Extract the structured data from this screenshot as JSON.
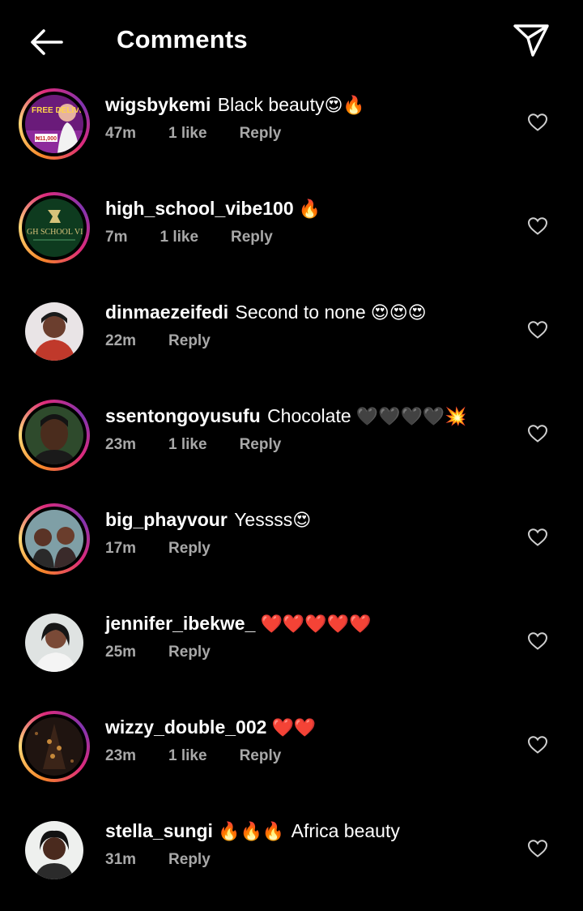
{
  "header": {
    "title": "Comments",
    "back_icon": "arrow-left-icon",
    "share_icon": "paper-plane-icon"
  },
  "colors": {
    "background": "#000000",
    "text": "#ffffff",
    "meta": "#a8a8a8",
    "story_ring": [
      "#f58529",
      "#dd2a7b",
      "#8134af"
    ]
  },
  "comments": [
    {
      "username": "wigsbykemi",
      "text": "Black beauty",
      "emojis": "😍🔥",
      "time": "47m",
      "likes": "1 like",
      "reply": "Reply",
      "story_ring": true,
      "avatar_text": "FREE DELIVERY",
      "avatar_price": "₦11,000"
    },
    {
      "username": "high_school_vibe100",
      "text": "",
      "emojis": " 🔥",
      "time": "7m",
      "likes": "1 like",
      "reply": "Reply",
      "story_ring": true,
      "avatar_text": "GH SCHOOL VI"
    },
    {
      "username": "dinmaezeifedi",
      "text": "Second to none",
      "emojis": " 😍😍😍",
      "time": "22m",
      "likes": "",
      "reply": "Reply",
      "story_ring": false
    },
    {
      "username": "ssentongoyusufu",
      "text": "Chocolate",
      "emojis": " 🖤🖤🖤🖤💥",
      "time": "23m",
      "likes": "1 like",
      "reply": "Reply",
      "story_ring": true
    },
    {
      "username": "big_phayvour",
      "text": "Yessss",
      "emojis": "😍",
      "time": "17m",
      "likes": "",
      "reply": "Reply",
      "story_ring": true
    },
    {
      "username": "jennifer_ibekwe_",
      "text": "",
      "emojis": " ❤️❤️❤️❤️❤️",
      "time": "25m",
      "likes": "",
      "reply": "Reply",
      "story_ring": false
    },
    {
      "username": "wizzy_double_002",
      "text": "",
      "emojis": " ❤️❤️",
      "time": "23m",
      "likes": "1 like",
      "reply": "Reply",
      "story_ring": true
    },
    {
      "username": "stella_sungi",
      "text": "Africa beauty",
      "emojis": " 🔥🔥🔥",
      "time": "31m",
      "likes": "",
      "reply": "Reply",
      "story_ring": false,
      "emoji_first": true
    }
  ]
}
